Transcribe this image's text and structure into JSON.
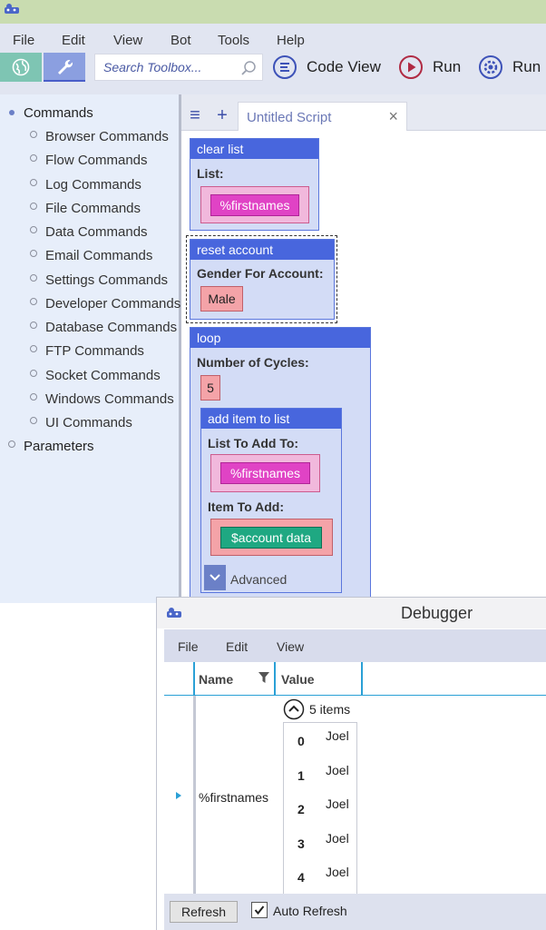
{
  "menubar": {
    "items": [
      "File",
      "Edit",
      "View",
      "Bot",
      "Tools",
      "Help"
    ]
  },
  "toolbar": {
    "search_placeholder": "Search Toolbox...",
    "code_view_label": "Code View",
    "run_label": "Run",
    "run_partial_label": "Run"
  },
  "sidebar": {
    "root_label": "Commands",
    "items": [
      "Browser Commands",
      "Flow Commands",
      "Log Commands",
      "File Commands",
      "Data Commands",
      "Email Commands",
      "Settings Commands",
      "Developer Commands",
      "Database Commands",
      "FTP Commands",
      "Socket Commands",
      "Windows Commands",
      "UI Commands"
    ],
    "parameters_label": "Parameters"
  },
  "editor": {
    "tab_menu_icon": "≡",
    "tab_add_icon": "+",
    "tab_title": "Untitled Script",
    "tab_close": "×",
    "blocks": {
      "clear_list": {
        "title": "clear list",
        "list_label": "List:",
        "list_value": "%firstnames"
      },
      "reset_account": {
        "title": "reset account",
        "gender_label": "Gender For Account:",
        "gender_value": "Male"
      },
      "loop": {
        "title": "loop",
        "cycles_label": "Number of Cycles:",
        "cycles_value": "5"
      },
      "add_item": {
        "title": "add item to list",
        "list_label": "List To Add To:",
        "list_value": "%firstnames",
        "item_label": "Item To Add:",
        "item_value": "$account data",
        "advanced_label": "Advanced"
      }
    }
  },
  "debugger": {
    "title": "Debugger",
    "menu": [
      "File",
      "Edit",
      "View"
    ],
    "columns": {
      "name": "Name",
      "value": "Value"
    },
    "row": {
      "name": "%firstnames",
      "count_label": "5 items",
      "items": [
        {
          "index": "0",
          "value": "Joel"
        },
        {
          "index": "1",
          "value": "Joel"
        },
        {
          "index": "2",
          "value": "Joel"
        },
        {
          "index": "3",
          "value": "Joel"
        },
        {
          "index": "4",
          "value": "Joel"
        }
      ]
    },
    "refresh_label": "Refresh",
    "auto_refresh_label": "Auto Refresh",
    "auto_refresh_checked": true
  },
  "colors": {
    "block_header": "#4866dd",
    "block_body": "#d3dcf6",
    "variable_chip": "#e043c5",
    "text_chip": "#f4a3a8",
    "data_chip": "#1fa882",
    "run_icon": "#b02a43",
    "accent_icon": "#3d52b8"
  }
}
